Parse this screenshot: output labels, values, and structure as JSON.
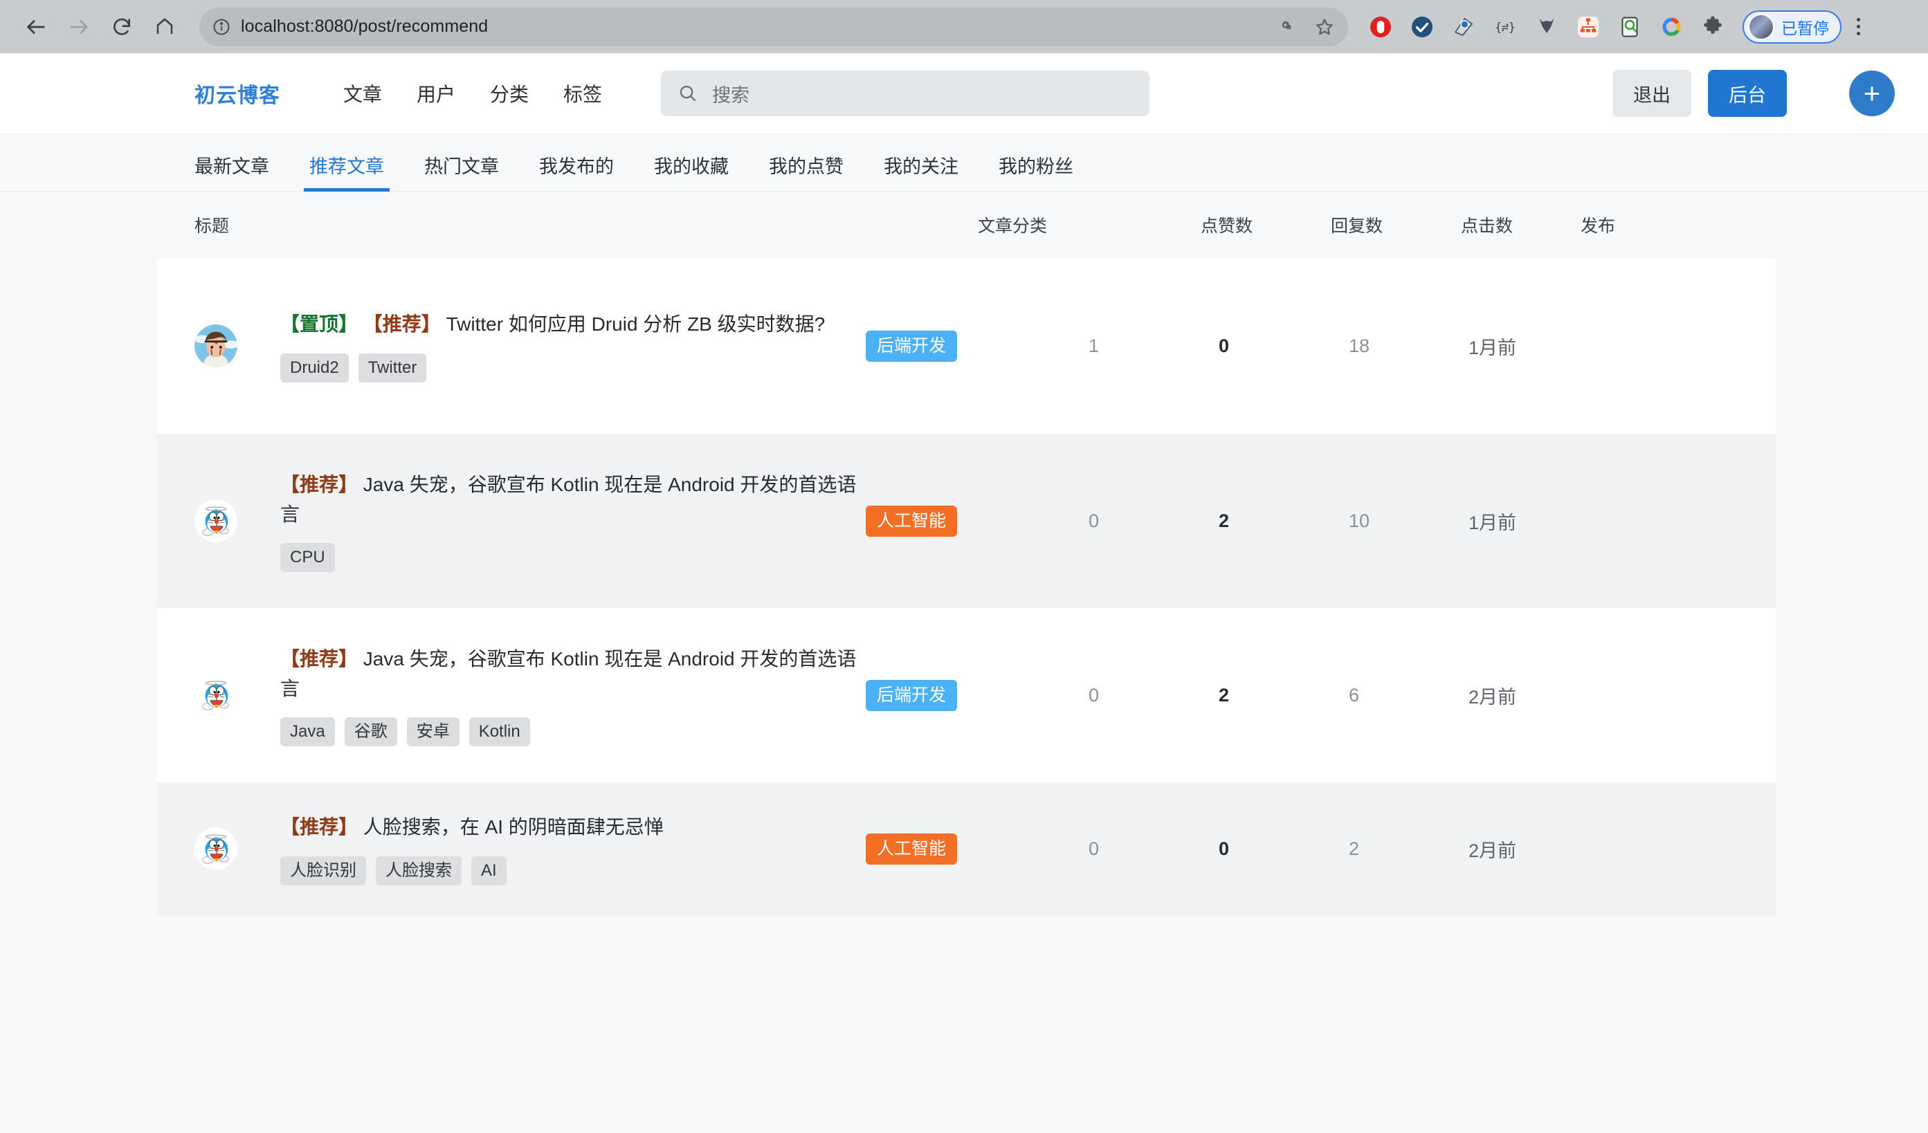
{
  "browser": {
    "url": "localhost:8080/post/recommend",
    "nav": {
      "back": "back-arrow",
      "forward": "forward-arrow",
      "reload": "reload",
      "home": "home"
    },
    "urlbar_icons": [
      "info-circle",
      "key-icon",
      "star-icon"
    ],
    "extensions": [
      "adblock-icon",
      "check-shield-icon",
      "snipaste-icon",
      "json-formatter-icon",
      "metamask-icon",
      "sitemap-icon",
      "keyword-icon",
      "google-icon",
      "puzzle-icon"
    ],
    "profile": {
      "label": "已暂停"
    },
    "menu": "kebab-menu"
  },
  "header": {
    "brand": "初云博客",
    "nav": [
      "文章",
      "用户",
      "分类",
      "标签"
    ],
    "search_placeholder": "搜索",
    "logout_label": "退出",
    "admin_label": "后台",
    "fab_label": "+"
  },
  "subtabs": {
    "items": [
      "最新文章",
      "推荐文章",
      "热门文章",
      "我发布的",
      "我的收藏",
      "我的点赞",
      "我的关注",
      "我的粉丝"
    ],
    "active_index": 1
  },
  "table": {
    "headers": {
      "title": "标题",
      "category": "文章分类",
      "likes": "点赞数",
      "replies": "回复数",
      "clicks": "点击数",
      "published": "发布"
    },
    "rows": [
      {
        "avatar": "anime-girl-avatar",
        "flags": [
          {
            "text": "【置顶】",
            "kind": "top"
          },
          {
            "text": "【推荐】",
            "kind": "recommend"
          }
        ],
        "title": "Twitter 如何应用 Druid 分析 ZB 级实时数据?",
        "tags": [
          "Druid2",
          "Twitter"
        ],
        "category": "后端开发",
        "category_color": "#4cb1f5",
        "likes": "1",
        "replies": "0",
        "clicks": "18",
        "published": "1月前"
      },
      {
        "avatar": "doraemon-avatar",
        "flags": [
          {
            "text": "【推荐】",
            "kind": "recommend"
          }
        ],
        "title": "Java 失宠，谷歌宣布 Kotlin 现在是 Android 开发的首选语言",
        "tags": [
          "CPU"
        ],
        "category": "人工智能",
        "category_color": "#f36f26",
        "likes": "0",
        "replies": "2",
        "clicks": "10",
        "published": "1月前"
      },
      {
        "avatar": "doraemon-avatar",
        "flags": [
          {
            "text": "【推荐】",
            "kind": "recommend"
          }
        ],
        "title": "Java 失宠，谷歌宣布 Kotlin 现在是 Android 开发的首选语言",
        "tags": [
          "Java",
          "谷歌",
          "安卓",
          "Kotlin"
        ],
        "category": "后端开发",
        "category_color": "#4cb1f5",
        "likes": "0",
        "replies": "2",
        "clicks": "6",
        "published": "2月前"
      },
      {
        "avatar": "doraemon-avatar",
        "flags": [
          {
            "text": "【推荐】",
            "kind": "recommend"
          }
        ],
        "title": "人脸搜索，在 AI 的阴暗面肆无忌惮",
        "tags": [
          "人脸识别",
          "人脸搜索",
          "AI"
        ],
        "category": "人工智能",
        "category_color": "#f36f26",
        "likes": "0",
        "replies": "0",
        "clicks": "2",
        "published": "2月前"
      }
    ]
  },
  "colors": {
    "brand_blue": "#2176d2",
    "flag_top_green": "#14772c",
    "flag_recommend_brown": "#8e3c18",
    "page_bg": "#f7f8fa"
  }
}
